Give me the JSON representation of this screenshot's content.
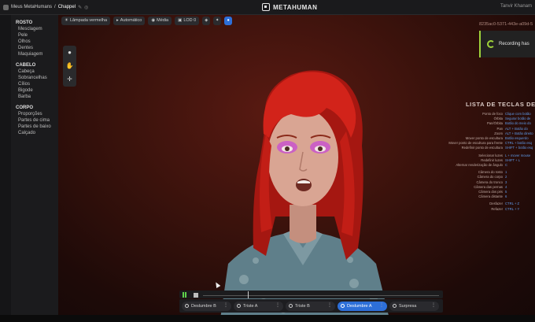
{
  "topbar": {
    "breadcrumb_root": "Meus MetaHumans",
    "breadcrumb_sep": "/",
    "breadcrumb_current": "Chappel",
    "brand": "METAHUMAN",
    "right_text": "Tanvir Khanam"
  },
  "sidebar": {
    "sections": [
      {
        "title": "ROSTO",
        "items": [
          "Mesclagem",
          "Pele",
          "Olhos",
          "Dentes",
          "Maquiagem"
        ]
      },
      {
        "title": "CABELO",
        "items": [
          "Cabeça",
          "Sobrancelhas",
          "Cílios",
          "Bigode",
          "Barba"
        ]
      },
      {
        "title": "CORPO",
        "items": [
          "Proporções",
          "Partes de cima",
          "Partes de baixo",
          "Calçado"
        ]
      }
    ]
  },
  "viewport_toolbar": {
    "lighting": "Lâmpada vermelha",
    "auto": "Automático",
    "quality": "Média",
    "lod": "LOD 0"
  },
  "tools": [
    "pointer-icon",
    "hand-icon",
    "move-icon"
  ],
  "id_text": "8235ac0-5371-443e-a09d-5",
  "recording": {
    "label": "Recording has"
  },
  "shortcuts": {
    "title": "LISTA DE TECLAS DE ATALHO",
    "groups": [
      [
        {
          "action": "Ponto de foco",
          "key": "Clique com botão"
        },
        {
          "action": "Órbita",
          "key": "Segurar botão de"
        },
        {
          "action": "Pan/Órbita",
          "key": "Botão do meio do"
        },
        {
          "action": "Pan",
          "key": "ALT + Botão do"
        },
        {
          "action": "Zoom",
          "key": "ALT + Botão direito"
        },
        {
          "action": "Mover ponto de escultura",
          "key": "Botão esquerdo"
        },
        {
          "action": "Mover ponto de escultura para frente",
          "key": "CTRL + botão esq"
        },
        {
          "action": "Redefinir ponto de escultura",
          "key": "SHIFT + botão esq"
        }
      ],
      [
        {
          "action": "Selecionar luzes",
          "key": "L + mover mouse"
        },
        {
          "action": "Redefinir luzes",
          "key": "SHIFT + L"
        },
        {
          "action": "Alternar renderização de ângulo",
          "key": "C"
        }
      ],
      [
        {
          "action": "Câmera do rosto",
          "key": "1"
        },
        {
          "action": "Câmera do corpo",
          "key": "2"
        },
        {
          "action": "Câmera do tronco",
          "key": "3"
        },
        {
          "action": "Câmera das pernas",
          "key": "4"
        },
        {
          "action": "Câmera dos pés",
          "key": "5"
        },
        {
          "action": "Câmera distante",
          "key": "6"
        }
      ],
      [
        {
          "action": "Desfazer",
          "key": "CTRL + Z"
        },
        {
          "action": "Refazer",
          "key": "CTRL + Y"
        }
      ]
    ]
  },
  "clips": [
    {
      "label": "Deslumbre B",
      "active": false
    },
    {
      "label": "Triste A",
      "active": false
    },
    {
      "label": "Triste B",
      "active": false
    },
    {
      "label": "Deslumbre A",
      "active": true
    },
    {
      "label": "Surpresa",
      "active": false
    }
  ],
  "colors": {
    "accent": "#2d6fd8",
    "play": "#5fd14a",
    "recording": "#9fd23a",
    "hair": "#d2231a",
    "eyeshadow": "#c64bd4"
  }
}
